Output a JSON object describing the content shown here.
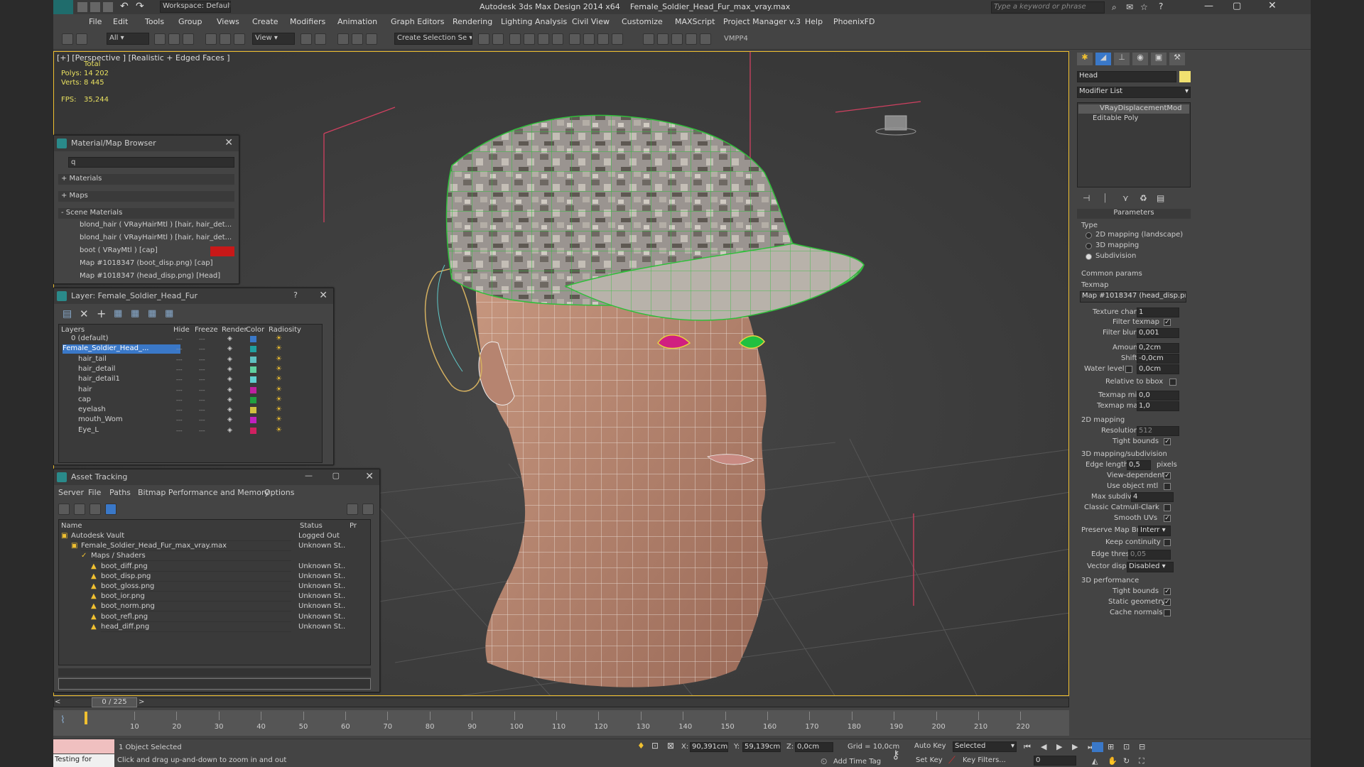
{
  "title": {
    "workspace": "Workspace: Default",
    "app": "Autodesk 3ds Max Design 2014 x64",
    "file": "Female_Soldier_Head_Fur_max_vray.max",
    "search_placeholder": "Type a keyword or phrase"
  },
  "menu": [
    "File",
    "Edit",
    "Tools",
    "Group",
    "Views",
    "Create",
    "Modifiers",
    "Animation",
    "Graph Editors",
    "Rendering",
    "Lighting Analysis",
    "Civil View",
    "Customize",
    "MAXScript",
    "Project Manager v.3",
    "Help",
    "PhoenixFD"
  ],
  "toolbar": {
    "filter": "All",
    "ref": "View",
    "selset": "Create Selection Se",
    "vmpp": "VMPP4"
  },
  "viewport": {
    "label": "[+] [Perspective ] [Realistic + Edged Faces ]",
    "total_label": "Total",
    "polys_label": "Polys:",
    "polys": "14 202",
    "verts_label": "Verts:",
    "verts": "8 445",
    "fps_label": "FPS:",
    "fps": "35,244"
  },
  "matbrowser": {
    "title": "Material/Map Browser",
    "search": "q",
    "materials": "+ Materials",
    "maps": "+ Maps",
    "scene": "- Scene Materials",
    "items": [
      "blond_hair  ( VRayHairMtl ) [hair, hair_det...",
      "blond_hair  ( VRayHairMtl ) [hair, hair_det...",
      "boot  ( VRayMtl ) [cap]",
      "Map #1018347 (boot_disp.png) [cap]",
      "Map #1018347 (head_disp.png) [Head]"
    ]
  },
  "layer": {
    "title": "Layer: Female_Soldier_Head_Fur",
    "help": "?",
    "cols": [
      "Layers",
      "Hide",
      "Freeze",
      "Render",
      "Color",
      "Radiosity"
    ],
    "items": [
      {
        "name": "0 (default)",
        "color": "#3a78c8"
      },
      {
        "name": "Female_Soldier_Head_...",
        "color": "#20a0a0",
        "selected": true
      },
      {
        "name": "hair_tail",
        "color": "#60c0c0"
      },
      {
        "name": "hair_detail",
        "color": "#60d0a0"
      },
      {
        "name": "hair_detail1",
        "color": "#60d0d0"
      },
      {
        "name": "hair",
        "color": "#c020a0"
      },
      {
        "name": "cap",
        "color": "#20a040"
      },
      {
        "name": "eyelash",
        "color": "#d0c040"
      },
      {
        "name": "mouth_Wom",
        "color": "#c020c0"
      },
      {
        "name": "Eye_L",
        "color": "#d02060"
      }
    ]
  },
  "asset": {
    "title": "Asset Tracking",
    "menu": [
      "Server",
      "File",
      "Paths",
      "Bitmap Performance and Memory",
      "Options"
    ],
    "cols": [
      "Name",
      "Status",
      "Pr"
    ],
    "rows": [
      {
        "name": "Autodesk Vault",
        "status": "Logged Out",
        "indent": 0
      },
      {
        "name": "Female_Soldier_Head_Fur_max_vray.max",
        "status": "Unknown St...",
        "indent": 1
      },
      {
        "name": "Maps / Shaders",
        "status": "",
        "indent": 2
      },
      {
        "name": "boot_diff.png",
        "status": "Unknown St...",
        "indent": 3
      },
      {
        "name": "boot_disp.png",
        "status": "Unknown St...",
        "indent": 3
      },
      {
        "name": "boot_gloss.png",
        "status": "Unknown St...",
        "indent": 3
      },
      {
        "name": "boot_ior.png",
        "status": "Unknown St...",
        "indent": 3
      },
      {
        "name": "boot_norm.png",
        "status": "Unknown St...",
        "indent": 3
      },
      {
        "name": "boot_refl.png",
        "status": "Unknown St...",
        "indent": 3
      },
      {
        "name": "head_diff.png",
        "status": "Unknown St...",
        "indent": 3
      }
    ]
  },
  "cmd": {
    "objname": "Head",
    "modlist": "Modifier List",
    "stack": [
      "VRayDisplacementMod",
      "Editable Poly"
    ],
    "params": "Parameters",
    "type": "Type",
    "type_opts": [
      "2D mapping (landscape)",
      "3D mapping",
      "Subdivision"
    ],
    "common": "Common params",
    "texmap": "Texmap",
    "texmap_val": "Map #1018347 (head_disp.png)",
    "texture_chan_label": "Texture chan",
    "texture_chan": "1",
    "filter_texmap": "Filter texmap",
    "filter_blur_label": "Filter blur",
    "filter_blur": "0,001",
    "amount_label": "Amount",
    "amount": "0,2cm",
    "shift_label": "Shift",
    "shift": "-0,0cm",
    "water_label": "Water level",
    "water": "0,0cm",
    "rel_bbox": "Relative to bbox",
    "texmin_label": "Texmap min",
    "texmin": "0,0",
    "texmax_label": "Texmap max",
    "texmax": "1,0",
    "map2d": "2D mapping",
    "res_label": "Resolution",
    "res": "512",
    "tight_bounds": "Tight bounds",
    "map3d": "3D mapping/subdivision",
    "edge_label": "Edge length",
    "edge": "0,5",
    "pixels": "pixels",
    "view_dep": "View-dependent",
    "use_obj": "Use object mtl",
    "maxsub_label": "Max subdivs",
    "maxsub": "4",
    "catmull": "Classic Catmull-Clark",
    "smooth_uv": "Smooth UVs",
    "pmb_label": "Preserve Map Bnd",
    "pmb": "Interr",
    "keep": "Keep continuity",
    "edge_thresh_label": "Edge thresh",
    "edge_thresh": "0,05",
    "vdisp_label": "Vector displ",
    "vdisp": "Disabled",
    "perf3d": "3D performance",
    "tight2": "Tight bounds",
    "static": "Static geometry",
    "cache": "Cache normals"
  },
  "timeline": {
    "frame": "0 / 225",
    "ticks": [
      "10",
      "20",
      "30",
      "40",
      "50",
      "60",
      "70",
      "80",
      "90",
      "100",
      "110",
      "120",
      "130",
      "140",
      "150",
      "160",
      "170",
      "180",
      "190",
      "200",
      "210",
      "220"
    ]
  },
  "status": {
    "script": "Testing for",
    "selected": "1 Object Selected",
    "hint": "Click and drag up-and-down to zoom in and out",
    "x_label": "X:",
    "x": "90,391cm",
    "y_label": "Y:",
    "y": "59,139cm",
    "z_label": "Z:",
    "z": "0,0cm",
    "grid": "Grid = 10,0cm",
    "autokey": "Auto Key",
    "selmode": "Selected",
    "setkey": "Set Key",
    "keyfilters": "Key Filters...",
    "addtime": "Add Time Tag",
    "frame": "0"
  }
}
